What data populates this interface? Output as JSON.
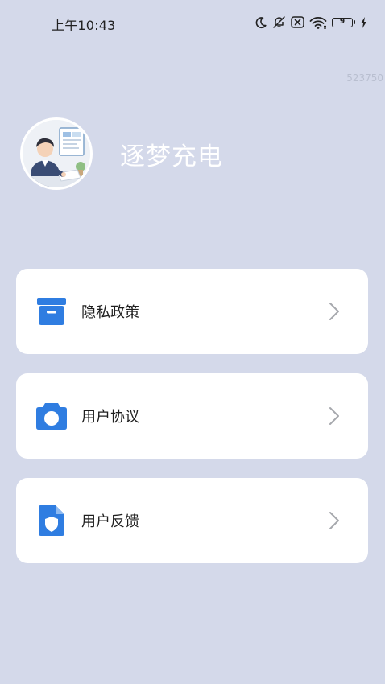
{
  "status_bar": {
    "time": "上午10:43",
    "battery_level": "9"
  },
  "watermark": "523750",
  "profile": {
    "app_name": "逐梦充电"
  },
  "menu": {
    "items": [
      {
        "label": "隐私政策",
        "icon": "folder-icon"
      },
      {
        "label": "用户协议",
        "icon": "camera-icon"
      },
      {
        "label": "用户反馈",
        "icon": "shield-document-icon"
      }
    ]
  },
  "colors": {
    "background": "#d4d9ea",
    "card": "#ffffff",
    "accent": "#2f7de1",
    "chevron": "#a6a8ad"
  }
}
